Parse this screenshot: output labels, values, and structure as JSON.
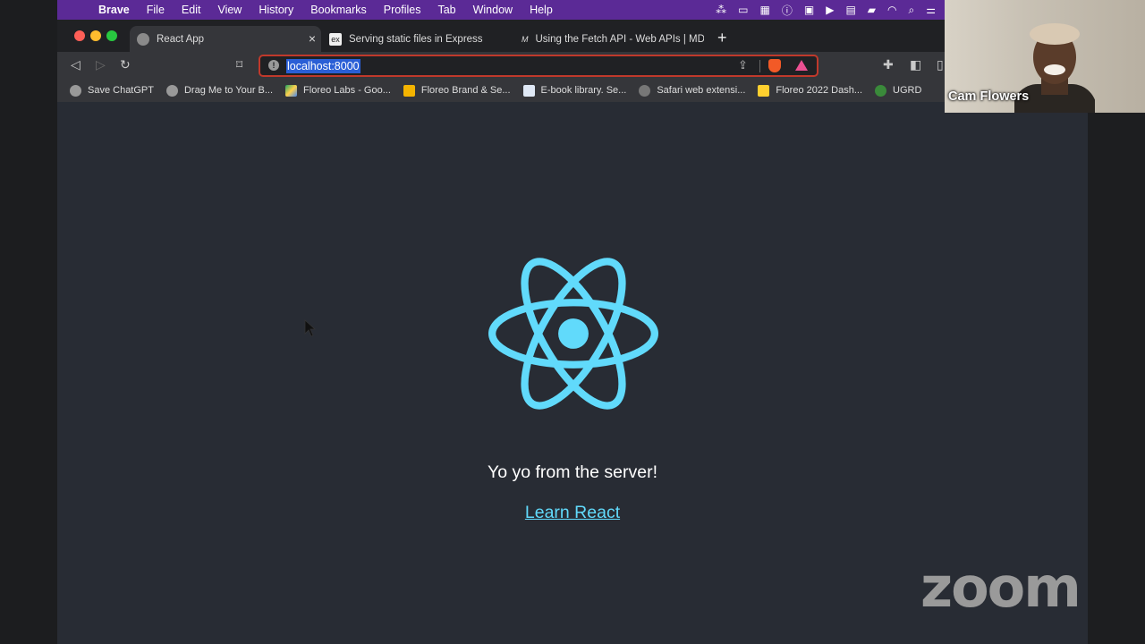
{
  "menubar": {
    "app": "Brave",
    "items": [
      "File",
      "Edit",
      "View",
      "History",
      "Bookmarks",
      "Profiles",
      "Tab",
      "Window",
      "Help"
    ]
  },
  "tabs": [
    {
      "title": "React App",
      "active": true,
      "icon": "globe-icon"
    },
    {
      "title": "Serving static files in Express",
      "active": false,
      "icon": "express-icon"
    },
    {
      "title": "Using the Fetch API - Web APIs | MDN",
      "active": false,
      "icon": "mdn-icon"
    }
  ],
  "address_bar": {
    "url": "localhost:8000"
  },
  "bookmarks": [
    {
      "label": "Save ChatGPT",
      "icon": "globe-icon"
    },
    {
      "label": "Drag Me to Your B...",
      "icon": "globe-icon"
    },
    {
      "label": "Floreo Labs - Goo...",
      "icon": "google-drive-icon"
    },
    {
      "label": "Floreo Brand & Se...",
      "icon": "slides-icon"
    },
    {
      "label": "E-book library. Se...",
      "icon": "ebook-icon"
    },
    {
      "label": "Safari web extensi...",
      "icon": "apple-icon"
    },
    {
      "label": "Floreo 2022 Dash...",
      "icon": "miro-icon"
    },
    {
      "label": "UGRD",
      "icon": "ugrd-icon"
    }
  ],
  "page": {
    "message": "Yo yo from the server!",
    "link": "Learn React"
  },
  "zoom": {
    "participant_name": "Cam Flowers",
    "watermark": "zoom"
  },
  "colors": {
    "menubar": "#5b2a96",
    "page_bg": "#282c34",
    "react_blue": "#61dafb",
    "url_highlight": "#2a5fd6"
  }
}
